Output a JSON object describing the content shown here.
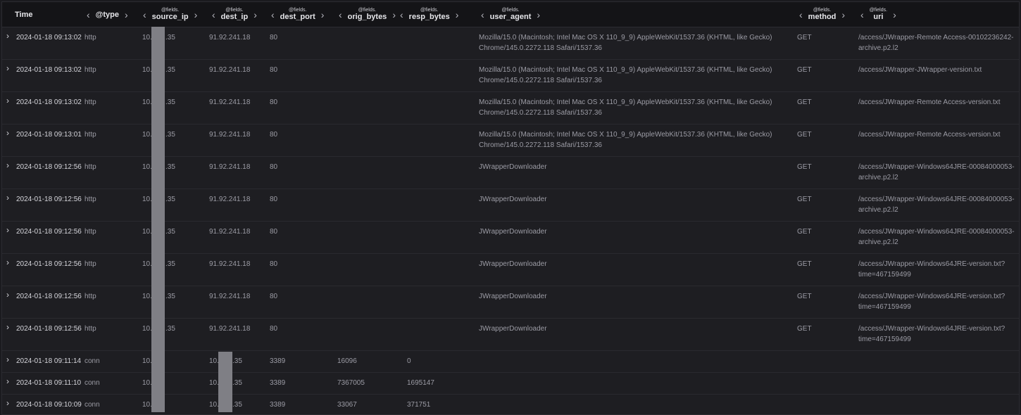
{
  "columns": [
    {
      "key": "time",
      "label": "Time",
      "prefix": ""
    },
    {
      "key": "type",
      "label": "@type",
      "prefix": ""
    },
    {
      "key": "source_ip",
      "label": "source_ip",
      "prefix": "@fields."
    },
    {
      "key": "dest_ip",
      "label": "dest_ip",
      "prefix": "@fields."
    },
    {
      "key": "dest_port",
      "label": "dest_port",
      "prefix": "@fields."
    },
    {
      "key": "orig_bytes",
      "label": "orig_bytes",
      "prefix": "@fields."
    },
    {
      "key": "resp_bytes",
      "label": "resp_bytes",
      "prefix": "@fields."
    },
    {
      "key": "user_agent",
      "label": "user_agent",
      "prefix": "@fields."
    },
    {
      "key": "method",
      "label": "method",
      "prefix": "@fields."
    },
    {
      "key": "uri",
      "label": "uri",
      "prefix": "@fields."
    }
  ],
  "icons": {
    "expand": "chevron-right-icon",
    "col_left": "chevron-left-icon",
    "col_right": "chevron-right-icon"
  },
  "glyphs": {
    "left": "‹",
    "right": "›",
    "expand": "›"
  },
  "colors": {
    "background": "#1e1e22",
    "header": "#141417",
    "redaction": "#7f7f85",
    "text": "#9c9ca5"
  },
  "rows": [
    {
      "time": "2024-01-18 09:13:02",
      "type": "http",
      "source_ip": "10.",
      "source_ip_tail": ".35",
      "dest_ip": "91.92.241.18",
      "dest_port": "80",
      "orig_bytes": "",
      "resp_bytes": "",
      "user_agent": "Mozilla/15.0 (Macintosh; Intel Mac OS X 110_9_9) AppleWebKit/1537.36 (KHTML, like Gecko) Chrome/145.0.2272.118 Safari/1537.36",
      "method": "GET",
      "uri": "/access/JWrapper-Remote Access-00102236242-archive.p2.l2"
    },
    {
      "time": "2024-01-18 09:13:02",
      "type": "http",
      "source_ip": "10.",
      "source_ip_tail": ".35",
      "dest_ip": "91.92.241.18",
      "dest_port": "80",
      "orig_bytes": "",
      "resp_bytes": "",
      "user_agent": "Mozilla/15.0 (Macintosh; Intel Mac OS X 110_9_9) AppleWebKit/1537.36 (KHTML, like Gecko) Chrome/145.0.2272.118 Safari/1537.36",
      "method": "GET",
      "uri": "/access/JWrapper-JWrapper-version.txt"
    },
    {
      "time": "2024-01-18 09:13:02",
      "type": "http",
      "source_ip": "10.",
      "source_ip_tail": ".35",
      "dest_ip": "91.92.241.18",
      "dest_port": "80",
      "orig_bytes": "",
      "resp_bytes": "",
      "user_agent": "Mozilla/15.0 (Macintosh; Intel Mac OS X 110_9_9) AppleWebKit/1537.36 (KHTML, like Gecko) Chrome/145.0.2272.118 Safari/1537.36",
      "method": "GET",
      "uri": "/access/JWrapper-Remote Access-version.txt"
    },
    {
      "time": "2024-01-18 09:13:01",
      "type": "http",
      "source_ip": "10.",
      "source_ip_tail": ".35",
      "dest_ip": "91.92.241.18",
      "dest_port": "80",
      "orig_bytes": "",
      "resp_bytes": "",
      "user_agent": "Mozilla/15.0 (Macintosh; Intel Mac OS X 110_9_9) AppleWebKit/1537.36 (KHTML, like Gecko) Chrome/145.0.2272.118 Safari/1537.36",
      "method": "GET",
      "uri": "/access/JWrapper-Remote Access-version.txt"
    },
    {
      "time": "2024-01-18 09:12:56",
      "type": "http",
      "source_ip": "10.",
      "source_ip_tail": ".35",
      "dest_ip": "91.92.241.18",
      "dest_port": "80",
      "orig_bytes": "",
      "resp_bytes": "",
      "user_agent": "JWrapperDownloader",
      "method": "GET",
      "uri": "/access/JWrapper-Windows64JRE-00084000053-archive.p2.l2"
    },
    {
      "time": "2024-01-18 09:12:56",
      "type": "http",
      "source_ip": "10.",
      "source_ip_tail": ".35",
      "dest_ip": "91.92.241.18",
      "dest_port": "80",
      "orig_bytes": "",
      "resp_bytes": "",
      "user_agent": "JWrapperDownloader",
      "method": "GET",
      "uri": "/access/JWrapper-Windows64JRE-00084000053-archive.p2.l2"
    },
    {
      "time": "2024-01-18 09:12:56",
      "type": "http",
      "source_ip": "10.",
      "source_ip_tail": ".35",
      "dest_ip": "91.92.241.18",
      "dest_port": "80",
      "orig_bytes": "",
      "resp_bytes": "",
      "user_agent": "JWrapperDownloader",
      "method": "GET",
      "uri": "/access/JWrapper-Windows64JRE-00084000053-archive.p2.l2"
    },
    {
      "time": "2024-01-18 09:12:56",
      "type": "http",
      "source_ip": "10.",
      "source_ip_tail": ".35",
      "dest_ip": "91.92.241.18",
      "dest_port": "80",
      "orig_bytes": "",
      "resp_bytes": "",
      "user_agent": "JWrapperDownloader",
      "method": "GET",
      "uri": "/access/JWrapper-Windows64JRE-version.txt?time=467159499"
    },
    {
      "time": "2024-01-18 09:12:56",
      "type": "http",
      "source_ip": "10.",
      "source_ip_tail": ".35",
      "dest_ip": "91.92.241.18",
      "dest_port": "80",
      "orig_bytes": "",
      "resp_bytes": "",
      "user_agent": "JWrapperDownloader",
      "method": "GET",
      "uri": "/access/JWrapper-Windows64JRE-version.txt?time=467159499"
    },
    {
      "time": "2024-01-18 09:12:56",
      "type": "http",
      "source_ip": "10.",
      "source_ip_tail": ".35",
      "dest_ip": "91.92.241.18",
      "dest_port": "80",
      "orig_bytes": "",
      "resp_bytes": "",
      "user_agent": "JWrapperDownloader",
      "method": "GET",
      "uri": "/access/JWrapper-Windows64JRE-version.txt?time=467159499"
    },
    {
      "time": "2024-01-18 09:11:14",
      "type": "conn",
      "source_ip": "10.",
      "source_ip_tail": "",
      "dest_ip": "10.",
      "dest_ip_tail": ".35",
      "dest_port": "3389",
      "orig_bytes": "16096",
      "resp_bytes": "0",
      "user_agent": "",
      "method": "",
      "uri": ""
    },
    {
      "time": "2024-01-18 09:11:10",
      "type": "conn",
      "source_ip": "10.",
      "source_ip_tail": "",
      "dest_ip": "10.",
      "dest_ip_tail": ".35",
      "dest_port": "3389",
      "orig_bytes": "7367005",
      "resp_bytes": "1695147",
      "user_agent": "",
      "method": "",
      "uri": ""
    },
    {
      "time": "2024-01-18 09:10:09",
      "type": "conn",
      "source_ip": "10.",
      "source_ip_tail": "",
      "dest_ip": "10.",
      "dest_ip_tail": ".35",
      "dest_port": "3389",
      "orig_bytes": "33067",
      "resp_bytes": "371751",
      "user_agent": "",
      "method": "",
      "uri": ""
    }
  ]
}
